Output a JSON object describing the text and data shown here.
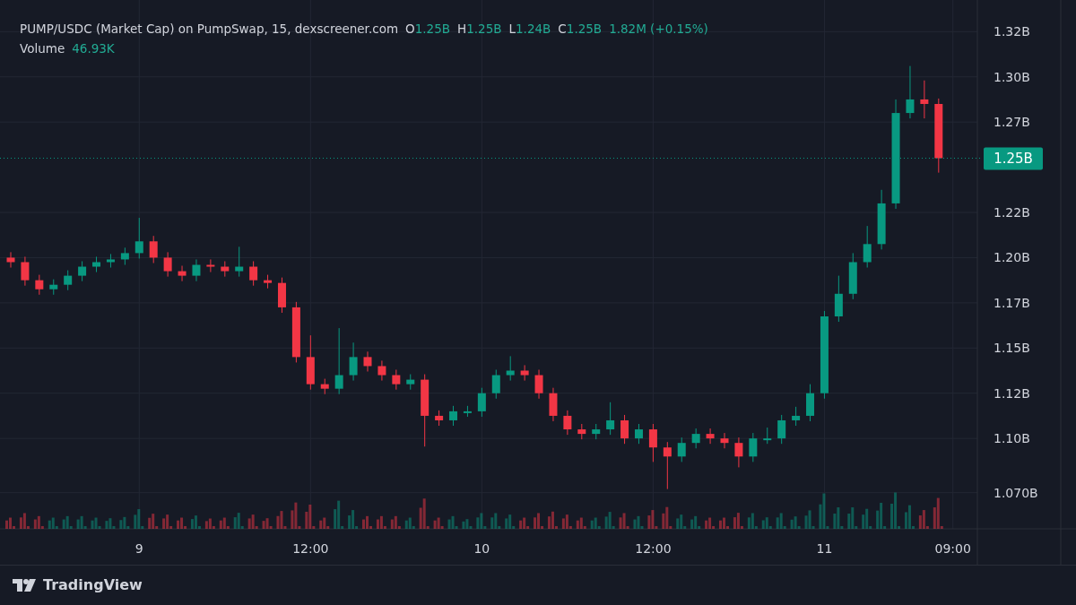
{
  "header": {
    "title": "PUMP/USDC (Market Cap) on PumpSwap, 15, dexscreener.com",
    "ohlc": [
      {
        "key": "O",
        "value": "1.25B"
      },
      {
        "key": "H",
        "value": "1.25B"
      },
      {
        "key": "L",
        "value": "1.24B"
      },
      {
        "key": "C",
        "value": "1.25B"
      }
    ],
    "change": "1.82M (+0.15%)"
  },
  "volume": {
    "label": "Volume",
    "value": "46.93K"
  },
  "chart": {
    "price_label": "1.25B",
    "chart_data": {
      "type": "candlestick",
      "ylim": [
        1.05,
        1.3425
      ],
      "grid": true,
      "ref_lines": [
        {
          "axis": "y",
          "value": 1.255
        }
      ],
      "categories": [
        null,
        null,
        null,
        null,
        null,
        null,
        null,
        null,
        null,
        "9",
        null,
        null,
        null,
        null,
        null,
        null,
        null,
        null,
        null,
        null,
        null,
        "12:00",
        null,
        null,
        null,
        null,
        null,
        null,
        null,
        null,
        null,
        null,
        null,
        "10",
        null,
        null,
        null,
        null,
        null,
        null,
        null,
        null,
        null,
        null,
        null,
        "12:00",
        null,
        null,
        null,
        null,
        null,
        null,
        null,
        null,
        null,
        null,
        null,
        "11",
        null,
        null,
        null,
        null,
        null,
        null,
        null,
        null,
        "09:00"
      ],
      "ohlc": [
        [
          1.2,
          1.203,
          1.1945,
          1.1975
        ],
        [
          1.1975,
          1.2005,
          1.1845,
          1.1875
        ],
        [
          1.1875,
          1.1905,
          1.1795,
          1.1825
        ],
        [
          1.1825,
          1.188,
          1.1795,
          1.185
        ],
        [
          1.185,
          1.193,
          1.182,
          1.19
        ],
        [
          1.19,
          1.198,
          1.187,
          1.195
        ],
        [
          1.195,
          1.2005,
          1.192,
          1.1975
        ],
        [
          1.1975,
          1.202,
          1.1945,
          1.199
        ],
        [
          1.199,
          1.2055,
          1.196,
          1.2025
        ],
        [
          1.2025,
          1.222,
          1.1995,
          1.209
        ],
        [
          1.209,
          1.212,
          1.197,
          1.2
        ],
        [
          1.2,
          1.203,
          1.1895,
          1.1925
        ],
        [
          1.1925,
          1.1955,
          1.187,
          1.19
        ],
        [
          1.19,
          1.199,
          1.187,
          1.196
        ],
        [
          1.196,
          1.199,
          1.192,
          1.195
        ],
        [
          1.195,
          1.198,
          1.1895,
          1.1925
        ],
        [
          1.1925,
          1.206,
          1.1895,
          1.195
        ],
        [
          1.195,
          1.198,
          1.1845,
          1.1875
        ],
        [
          1.1875,
          1.1905,
          1.183,
          1.186
        ],
        [
          1.186,
          1.189,
          1.1695,
          1.1725
        ],
        [
          1.1725,
          1.1755,
          1.142,
          1.145
        ],
        [
          1.145,
          1.157,
          1.127,
          1.13
        ],
        [
          1.13,
          1.133,
          1.1245,
          1.1275
        ],
        [
          1.1275,
          1.161,
          1.1245,
          1.135
        ],
        [
          1.135,
          1.153,
          1.132,
          1.145
        ],
        [
          1.145,
          1.148,
          1.137,
          1.14
        ],
        [
          1.14,
          1.143,
          1.132,
          1.135
        ],
        [
          1.135,
          1.138,
          1.127,
          1.13
        ],
        [
          1.13,
          1.1355,
          1.127,
          1.1325
        ],
        [
          1.1325,
          1.1355,
          1.0955,
          1.1125
        ],
        [
          1.1125,
          1.1155,
          1.107,
          1.11
        ],
        [
          1.11,
          1.118,
          1.107,
          1.115
        ],
        [
          1.115,
          1.118,
          1.112,
          1.115
        ],
        [
          1.115,
          1.128,
          1.112,
          1.125
        ],
        [
          1.125,
          1.138,
          1.122,
          1.135
        ],
        [
          1.135,
          1.1455,
          1.132,
          1.1375
        ],
        [
          1.1375,
          1.1405,
          1.132,
          1.135
        ],
        [
          1.135,
          1.138,
          1.122,
          1.125
        ],
        [
          1.125,
          1.128,
          1.1095,
          1.1125
        ],
        [
          1.1125,
          1.1155,
          1.102,
          1.105
        ],
        [
          1.105,
          1.108,
          1.0995,
          1.1025
        ],
        [
          1.1025,
          1.108,
          1.0995,
          1.105
        ],
        [
          1.105,
          1.12,
          1.102,
          1.11
        ],
        [
          1.11,
          1.113,
          1.097,
          1.1
        ],
        [
          1.1,
          1.108,
          1.097,
          1.105
        ],
        [
          1.105,
          1.108,
          1.087,
          1.095
        ],
        [
          1.095,
          1.098,
          1.072,
          1.09
        ],
        [
          1.09,
          1.1005,
          1.087,
          1.0975
        ],
        [
          1.0975,
          1.1055,
          1.0945,
          1.1025
        ],
        [
          1.1025,
          1.1055,
          1.097,
          1.1
        ],
        [
          1.1,
          1.103,
          1.0945,
          1.0975
        ],
        [
          1.0975,
          1.1005,
          1.084,
          1.09
        ],
        [
          1.09,
          1.103,
          1.087,
          1.1
        ],
        [
          1.1,
          1.106,
          1.097,
          1.1
        ],
        [
          1.1,
          1.113,
          1.097,
          1.11
        ],
        [
          1.11,
          1.1175,
          1.107,
          1.1125
        ],
        [
          1.1125,
          1.13,
          1.1095,
          1.125
        ],
        [
          1.125,
          1.1705,
          1.122,
          1.1675
        ],
        [
          1.1675,
          1.19,
          1.1645,
          1.18
        ],
        [
          1.18,
          1.2025,
          1.177,
          1.1975
        ],
        [
          1.1975,
          1.2175,
          1.1945,
          1.2075
        ],
        [
          1.2075,
          1.2375,
          1.2045,
          1.23
        ],
        [
          1.23,
          1.2875,
          1.227,
          1.28
        ],
        [
          1.28,
          1.306,
          1.277,
          1.2875
        ],
        [
          1.2875,
          1.298,
          1.277,
          1.285
        ],
        [
          1.285,
          1.288,
          1.247,
          1.255
        ],
        null
      ],
      "yticks": [
        {
          "value": 1.325,
          "label": "1.32B"
        },
        {
          "value": 1.3,
          "label": "1.30B"
        },
        {
          "value": 1.275,
          "label": "1.27B"
        },
        {
          "value": 1.225,
          "label": "1.22B"
        },
        {
          "value": 1.2,
          "label": "1.20B"
        },
        {
          "value": 1.175,
          "label": "1.17B"
        },
        {
          "value": 1.15,
          "label": "1.15B"
        },
        {
          "value": 1.125,
          "label": "1.12B"
        },
        {
          "value": 1.1,
          "label": "1.10B"
        },
        {
          "value": 1.07,
          "label": "1.070B"
        }
      ]
    }
  },
  "footer": {
    "brand": "TradingView"
  }
}
